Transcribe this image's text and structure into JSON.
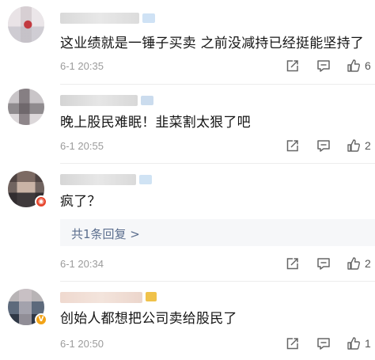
{
  "comments": [
    {
      "content": "这业绩就是一锤子买卖 之前没减持已经挺能坚持了",
      "time": "6-1 20:35",
      "likes": "6"
    },
    {
      "content": "晚上股民难眠！韭菜割太狠了吧",
      "time": "6-1 20:55",
      "likes": "2"
    },
    {
      "content": "疯了？",
      "time": "6-1 20:34",
      "likes": "2",
      "reply_label": "共1条回复 >"
    },
    {
      "content": "创始人都想把公司卖给股民了",
      "time": "6-1 20:50",
      "likes": "1"
    }
  ],
  "icons": {
    "share": "share-icon",
    "comment": "comment-icon",
    "like": "thumbs-up-icon",
    "badge_red": "weibo-badge-icon",
    "badge_gold": "verified-v-icon"
  },
  "colors": {
    "text": "#151515",
    "meta": "#9b9b9b",
    "reply_link": "#5b6e8e",
    "reply_bg": "#f6f7f9"
  }
}
